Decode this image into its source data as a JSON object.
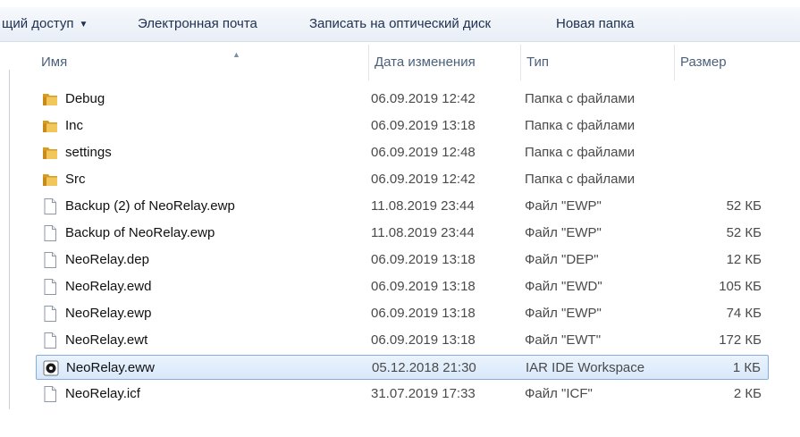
{
  "toolbar": {
    "share": "щий доступ",
    "email": "Электронная почта",
    "burn": "Записать на оптический диск",
    "new_folder": "Новая папка"
  },
  "columns": {
    "name": "Имя",
    "date": "Дата изменения",
    "type": "Тип",
    "size": "Размер"
  },
  "files": [
    {
      "name": "Debug",
      "date": "06.09.2019 12:42",
      "type": "Папка с файлами",
      "size": "",
      "icon": "folder-icon"
    },
    {
      "name": "Inc",
      "date": "06.09.2019 13:18",
      "type": "Папка с файлами",
      "size": "",
      "icon": "folder-icon"
    },
    {
      "name": "settings",
      "date": "06.09.2019 12:48",
      "type": "Папка с файлами",
      "size": "",
      "icon": "folder-icon"
    },
    {
      "name": "Src",
      "date": "06.09.2019 12:42",
      "type": "Папка с файлами",
      "size": "",
      "icon": "folder-icon"
    },
    {
      "name": "Backup (2) of NeoRelay.ewp",
      "date": "11.08.2019 23:44",
      "type": "Файл \"EWP\"",
      "size": "52 КБ",
      "icon": "file-icon"
    },
    {
      "name": "Backup of NeoRelay.ewp",
      "date": "11.08.2019 23:44",
      "type": "Файл \"EWP\"",
      "size": "52 КБ",
      "icon": "file-icon"
    },
    {
      "name": "NeoRelay.dep",
      "date": "06.09.2019 13:18",
      "type": "Файл \"DEP\"",
      "size": "12 КБ",
      "icon": "file-icon"
    },
    {
      "name": "NeoRelay.ewd",
      "date": "06.09.2019 13:18",
      "type": "Файл \"EWD\"",
      "size": "105 КБ",
      "icon": "file-icon"
    },
    {
      "name": "NeoRelay.ewp",
      "date": "06.09.2019 13:18",
      "type": "Файл \"EWP\"",
      "size": "74 КБ",
      "icon": "file-icon"
    },
    {
      "name": "NeoRelay.ewt",
      "date": "06.09.2019 13:18",
      "type": "Файл \"EWT\"",
      "size": "172 КБ",
      "icon": "file-icon"
    },
    {
      "name": "NeoRelay.eww",
      "date": "05.12.2018 21:30",
      "type": "IAR IDE Workspace",
      "size": "1 КБ",
      "icon": "workspace-icon",
      "selected": true
    },
    {
      "name": "NeoRelay.icf",
      "date": "31.07.2019 17:33",
      "type": "Файл \"ICF\"",
      "size": "2 КБ",
      "icon": "file-icon"
    }
  ],
  "colors": {
    "selection_fill": "#d8e8fa",
    "selection_border": "#84acdd",
    "folder": "#e8b640",
    "header_text": "#4c607a"
  }
}
